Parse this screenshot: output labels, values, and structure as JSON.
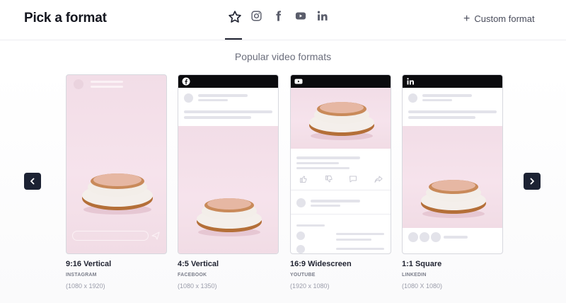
{
  "header": {
    "title": "Pick a format",
    "tabs": [
      {
        "name": "star",
        "icon": "star-icon",
        "active": true
      },
      {
        "name": "instagram",
        "icon": "instagram-icon",
        "active": false
      },
      {
        "name": "facebook",
        "icon": "facebook-icon",
        "active": false
      },
      {
        "name": "youtube",
        "icon": "youtube-icon",
        "active": false
      },
      {
        "name": "linkedin",
        "icon": "linkedin-icon",
        "active": false
      }
    ],
    "custom_format_label": "Custom format"
  },
  "section_title": "Popular video formats",
  "formats": [
    {
      "title": "9:16 Vertical",
      "platform": "INSTAGRAM",
      "dimensions": "(1080 x 1920)"
    },
    {
      "title": "4:5 Vertical",
      "platform": "FACEBOOK",
      "dimensions": "(1080 x 1350)"
    },
    {
      "title": "16:9 Widescreen",
      "platform": "YOUTUBE",
      "dimensions": "(1920 x 1080)"
    },
    {
      "title": "1:1 Square",
      "platform": "LINKEDIN",
      "dimensions": "(1080 X 1080)"
    }
  ],
  "colors": {
    "dark": "#1c2233",
    "accent_pink": "#f2dde7",
    "placeholder": "#e3e3ea"
  }
}
